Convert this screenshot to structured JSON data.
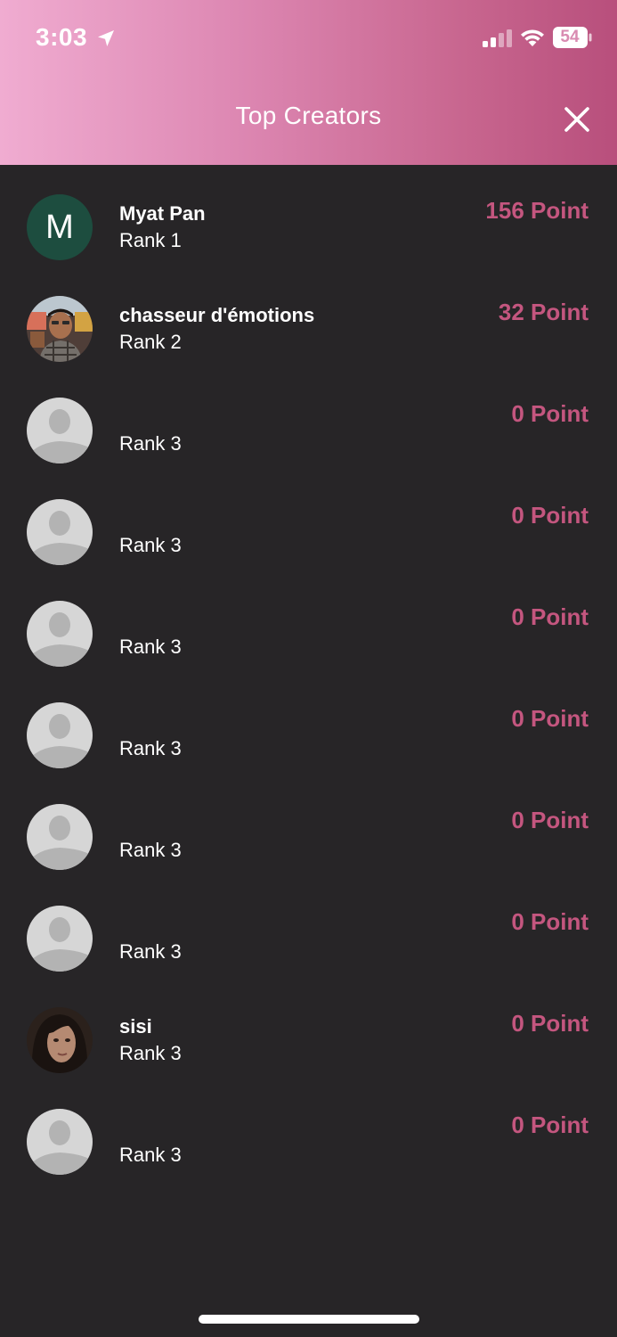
{
  "status_bar": {
    "time": "3:03",
    "battery": "54"
  },
  "header": {
    "title": "Top Creators"
  },
  "creators": [
    {
      "name": "Myat Pan",
      "rank": "Rank 1",
      "points": "156 Point",
      "avatar": "letter",
      "initial": "M"
    },
    {
      "name": "chasseur d'émotions",
      "rank": "Rank 2",
      "points": "32 Point",
      "avatar": "photo-man"
    },
    {
      "name": "",
      "rank": "Rank 3",
      "points": "0 Point",
      "avatar": "placeholder"
    },
    {
      "name": "",
      "rank": "Rank 3",
      "points": "0 Point",
      "avatar": "placeholder"
    },
    {
      "name": "",
      "rank": "Rank 3",
      "points": "0 Point",
      "avatar": "placeholder"
    },
    {
      "name": "",
      "rank": "Rank 3",
      "points": "0 Point",
      "avatar": "placeholder"
    },
    {
      "name": "",
      "rank": "Rank 3",
      "points": "0 Point",
      "avatar": "placeholder"
    },
    {
      "name": "",
      "rank": "Rank 3",
      "points": "0 Point",
      "avatar": "placeholder"
    },
    {
      "name": "sisi",
      "rank": "Rank 3",
      "points": "0 Point",
      "avatar": "photo-woman"
    },
    {
      "name": "",
      "rank": "Rank 3",
      "points": "0 Point",
      "avatar": "placeholder"
    }
  ],
  "colors": {
    "accent": "#c4567f",
    "background": "#272527",
    "header_gradient_start": "#f0acd1",
    "header_gradient_end": "#b84f7c"
  },
  "icons": {
    "location": "location-arrow-icon",
    "signal": "cellular-signal-icon",
    "wifi": "wifi-icon",
    "battery": "battery-icon",
    "close": "close-icon"
  }
}
